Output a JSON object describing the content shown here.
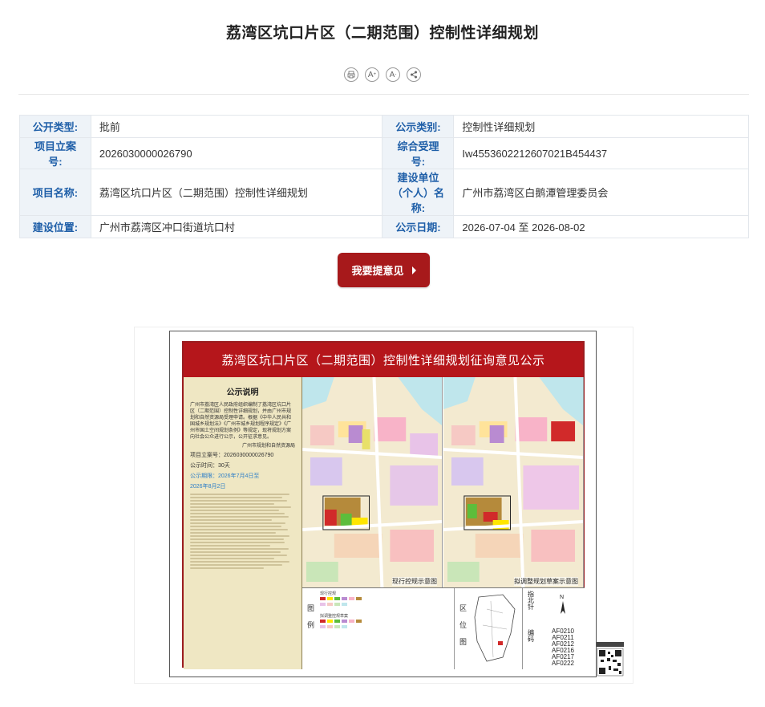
{
  "page": {
    "title": "荔湾区坑口片区（二期范围）控制性详细规划"
  },
  "toolbar": {
    "print_icon": "printer-icon",
    "font_up_label": "A",
    "font_down_label": "A",
    "share_icon": "share-icon"
  },
  "info": {
    "row1": {
      "k1": "公开类型:",
      "v1": "批前",
      "k2": "公示类别:",
      "v2": "控制性详细规划"
    },
    "row2": {
      "k1": "项目立案号:",
      "v1": "2026030000026790",
      "k2": "综合受理号:",
      "v2": "Iw455360221260702​1B454437"
    },
    "row3": {
      "k1": "项目名称:",
      "v1": "荔湾区坑口片区（二期范围）控制性详细规划",
      "k2": "建设单位（个人）名称:",
      "v2": "广州市荔湾区白鹅潭管理委员会"
    },
    "row4": {
      "k1": "建设位置:",
      "v1": "广州市荔湾区冲口街道坑口村",
      "k2": "公示日期:",
      "v2": "2026-07-04 至 2026-08-02"
    }
  },
  "actions": {
    "suggest_label": "我要提意见"
  },
  "poster": {
    "headline": "荔湾区坑口片区（二期范围）控制性详细规划征询意见公示",
    "notice_title": "公示说明",
    "notice_body": "广州市荔湾区人民政府组织编制了荔湾区坑口片区（二期范围）控制性详细规划，并由广州市规划和自然资源局受理申请。根据《中华人民共和国城乡规划法》《广州市城乡规划程序规定》《广州市国土空间规划条例》等规定，现将规划方案向社会公众进行公示，公开征求意见。",
    "notice_org": "广州市规划和自然资源局",
    "case_no": "项目立案号：2026030000026790",
    "period": "公示时间：30天",
    "dates_line1": "公示期限：2026年7月4日至",
    "dates_line2": "2026年8月2日",
    "map_left_caption": "现行控规示意图",
    "map_right_caption": "拟调整规划草案示意图",
    "legend_label": "图例",
    "location_label": "区位图",
    "north_label": "指北针",
    "code_label": "编码",
    "codes": [
      "AF0210",
      "AF0211",
      "AF0212",
      "AF0216",
      "AF0217",
      "AF0222"
    ],
    "legend_head1": "现行控规",
    "legend_head2": "拟调整控规草案"
  },
  "colors": {
    "accent_red": "#a7191b",
    "key_text": "#1f5fa8",
    "key_bg": "#eef3f8"
  }
}
